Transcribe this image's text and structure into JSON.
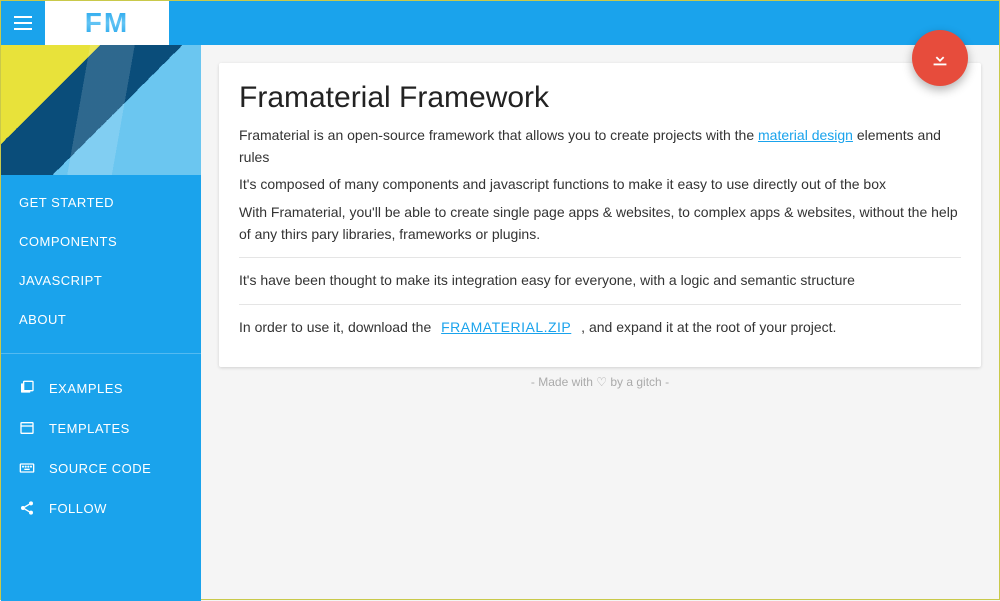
{
  "header": {
    "logo_text": "FM"
  },
  "sidebar": {
    "primary": [
      {
        "label": "GET STARTED"
      },
      {
        "label": "COMPONENTS"
      },
      {
        "label": "JAVASCRIPT"
      },
      {
        "label": "ABOUT"
      }
    ],
    "secondary": [
      {
        "label": "EXAMPLES",
        "icon": "stack-icon"
      },
      {
        "label": "TEMPLATES",
        "icon": "layout-icon"
      },
      {
        "label": "SOURCE CODE",
        "icon": "keyboard-icon"
      },
      {
        "label": "FOLLOW",
        "icon": "share-icon"
      }
    ]
  },
  "main": {
    "title": "Framaterial Framework",
    "p1a": "Framaterial is an open-source framework that allows you to create projects with the ",
    "p1_link": "material design",
    "p1b": " elements and rules",
    "p2": "It's composed of many components and javascript functions to make it easy to use directly out of the box",
    "p3": "With Framaterial, you'll be able to create single page apps & websites, to complex apps & websites, without the help of any thirs pary libraries, frameworks or plugins.",
    "p4": "It's have been thought to make its integration easy for everyone, with a logic and semantic structure",
    "p5a": "In order to use it, download the ",
    "download_label": "FRAMATERIAL.ZIP",
    "p5b": " , and expand it at the root of your project."
  },
  "footer": {
    "text": "- Made with ♡ by a gitch -"
  },
  "colors": {
    "primary": "#1aa3ec",
    "accent": "#e74c3c"
  }
}
